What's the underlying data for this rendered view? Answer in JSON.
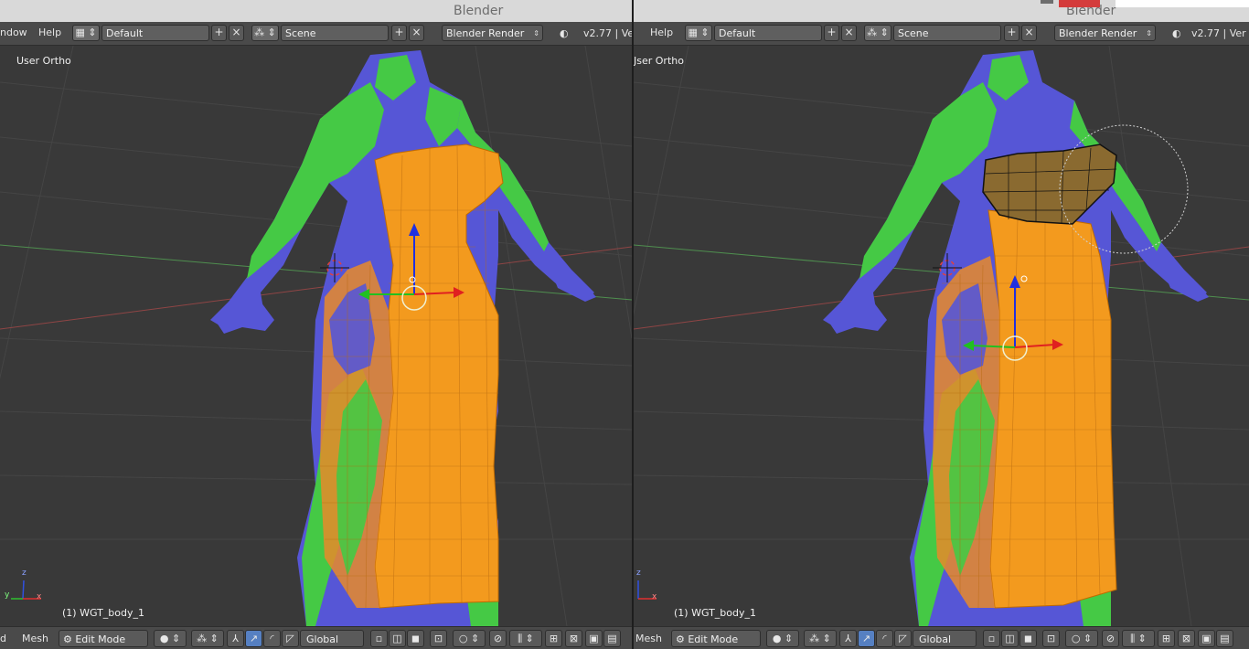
{
  "app_title": "Blender",
  "left_panel": {
    "menus": [
      "ndow",
      "Help"
    ],
    "layout": "Default",
    "scene": "Scene",
    "render_engine": "Blender Render",
    "version": "v2.77 | Ver",
    "view_label": "User Ortho",
    "object_label": "(1) WGT_body_1",
    "bottom_menus": [
      "d",
      "Mesh"
    ],
    "mode": "Edit Mode",
    "orientation": "Global"
  },
  "right_panel": {
    "menus": [
      "Help"
    ],
    "layout": "Default",
    "scene": "Scene",
    "render_engine": "Blender Render",
    "version": "v2.77 | Ver",
    "view_label": "Jser Ortho",
    "object_label": "(1) WGT_body_1",
    "bottom_menus": [
      "Mesh"
    ],
    "mode": "Edit Mode",
    "orientation": "Global"
  },
  "axis_labels": {
    "z": "z",
    "x": "x",
    "y": "y"
  },
  "colors": {
    "background": "#393939",
    "header": "#4a4a4a",
    "titlebar": "#d9d9d9",
    "dress": "#f39a1e",
    "body_blue": "#5656d6",
    "body_green": "#45c945",
    "selected_mesh": "#1a1a1a",
    "gizmo_x": "#e02020",
    "gizmo_y": "#20c020",
    "gizmo_z": "#2030e0"
  }
}
